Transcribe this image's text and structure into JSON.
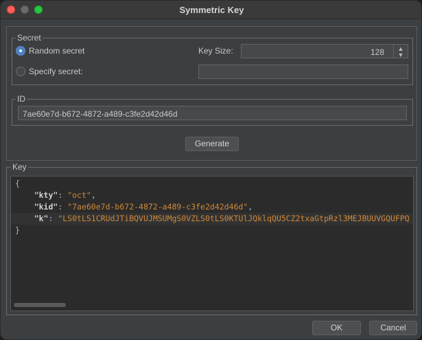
{
  "window": {
    "title": "Symmetric Key"
  },
  "secret_group": {
    "legend": "Secret",
    "random_label": "Random secret",
    "specify_label": "Specify secret:",
    "key_size_label": "Key Size:",
    "key_size_value": "128",
    "selected": "random"
  },
  "id_group": {
    "legend": "ID",
    "value": "7ae60e7d-b672-4872-a489-c3fe2d42d46d"
  },
  "generate_label": "Generate",
  "key_group": {
    "legend": "Key",
    "lines": {
      "open": "{",
      "kty_key": "\"kty\"",
      "kty_value": "\"oct\"",
      "kid_key": "\"kid\"",
      "kid_value": "\"7ae60e7d-b672-4872-a489-c3fe2d42d46d\"",
      "k_key": "\"k\"",
      "k_value": "\"LS0tLS1CRUdJTiBQVUJMSUMgS0VZLS0tLS0KTUlJQklqQU5CZ2txaGtpRzl3MEJBUUVGQUFPQ",
      "close": "}"
    }
  },
  "buttons": {
    "ok": "OK",
    "cancel": "Cancel"
  }
}
